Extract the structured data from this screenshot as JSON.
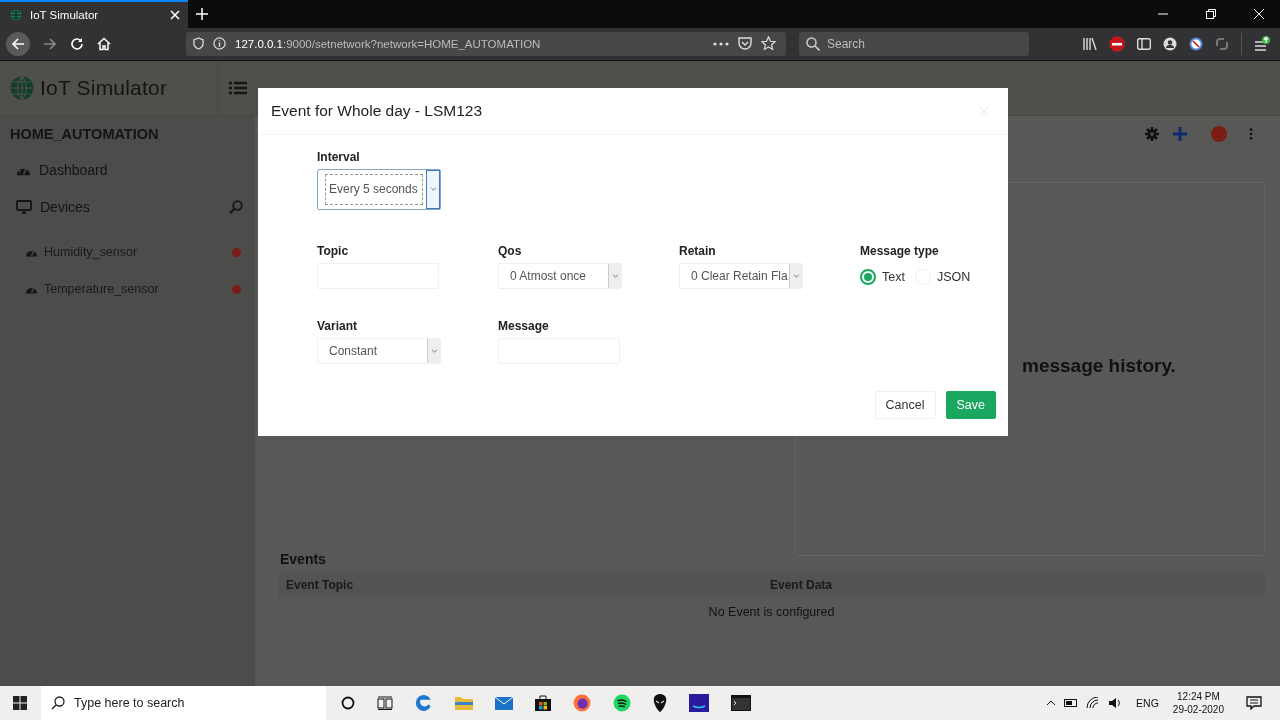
{
  "browser": {
    "tab": {
      "title": "IoT Simulator",
      "selected": true
    },
    "url_host": "127.0.0.1",
    "url_rest": ":9000/setnetwork?network=HOME_AUTOMATION",
    "search": {
      "placeholder": "Search"
    }
  },
  "app": {
    "logo": "IoT Simulator",
    "network": "HOME_AUTOMATION",
    "nav": [
      {
        "label": "Dashboard",
        "kind": "dashboard"
      },
      {
        "label": "Devices",
        "kind": "devices"
      }
    ],
    "devices": [
      {
        "name": "Humidity_sensor",
        "color": "#7a1d14"
      },
      {
        "name": "Temperature_sensor",
        "color": "#7a1d14"
      }
    ],
    "connection": {
      "color": "#7a1d14"
    },
    "history_text": "message history.",
    "events": {
      "title": "Events",
      "columns": [
        "Event Topic",
        "Event Data"
      ],
      "empty": "No Event is configured"
    }
  },
  "modal": {
    "title": "Event for Whole day - LSM123",
    "rows": [
      [
        {
          "label": "Interval",
          "kind": "select",
          "value": "Every 5 seconds",
          "focused": true
        }
      ],
      [
        {
          "label": "Topic",
          "kind": "input"
        },
        {
          "label": "Qos",
          "kind": "select",
          "value": "0 Atmost once",
          "focused": false
        },
        {
          "label": "Retain",
          "kind": "select",
          "value": "0 Clear Retain Fla",
          "focused": false
        },
        {
          "label": "Message type",
          "kind": "radio",
          "options": [
            {
              "label": "Text",
              "selected": true
            },
            {
              "label": "JSON",
              "selected": false
            }
          ]
        }
      ],
      [
        {
          "label": "Variant",
          "kind": "select",
          "value": "Constant",
          "focused": false
        },
        {
          "label": "Message",
          "kind": "input"
        }
      ]
    ],
    "buttons": [
      {
        "label": "Cancel",
        "kind": "secondary"
      },
      {
        "label": "Save",
        "kind": "primary"
      }
    ]
  },
  "taskbar": {
    "search": {
      "placeholder": "Type here to search"
    },
    "language": "ENG",
    "time": "12:24 PM",
    "date": "29-02-2020"
  }
}
